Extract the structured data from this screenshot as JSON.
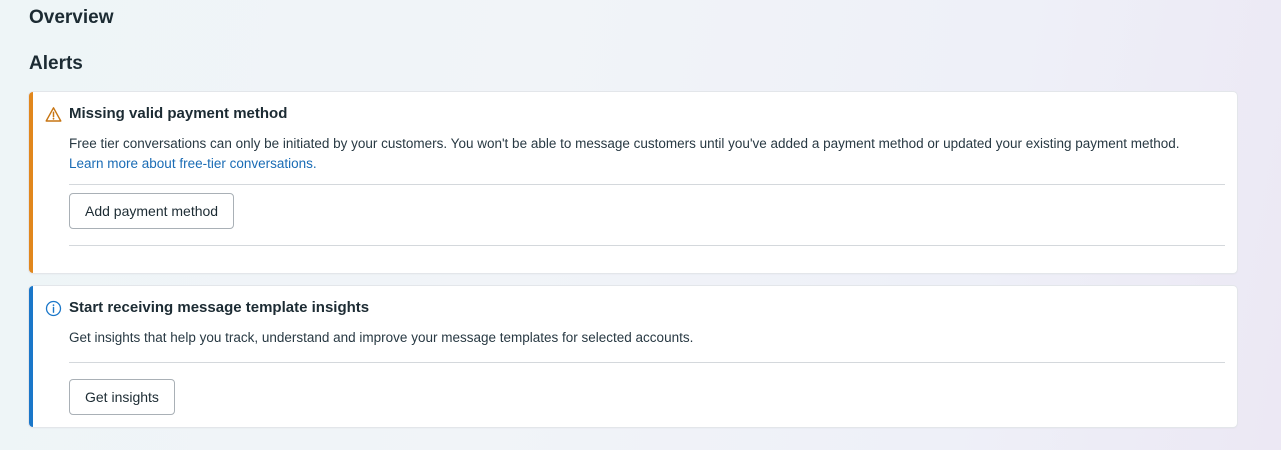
{
  "page": {
    "title": "Overview"
  },
  "alerts_section": {
    "title": "Alerts",
    "items": [
      {
        "type": "warning",
        "icon": "warning-triangle-icon",
        "accent_color": "#e1871d",
        "title": "Missing valid payment method",
        "body": "Free tier conversations can only be initiated by your customers. You won't be able to message customers until you've added a payment method or updated your existing payment method.",
        "link_text": "Learn more about free-tier conversations.",
        "button_label": "Add payment method"
      },
      {
        "type": "info",
        "icon": "info-circle-icon",
        "accent_color": "#1a77c9",
        "title": "Start receiving message template insights",
        "body": "Get insights that help you track, understand and improve your message templates for selected accounts.",
        "button_label": "Get insights"
      }
    ]
  }
}
